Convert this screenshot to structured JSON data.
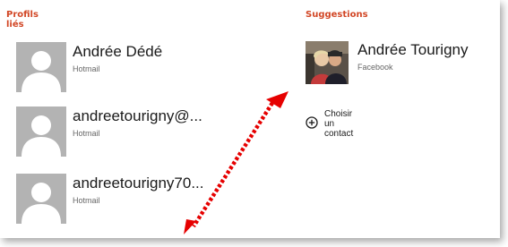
{
  "linked_profiles": {
    "title": "Profils liés",
    "items": [
      {
        "name": "Andrée Dédé",
        "service": "Hotmail"
      },
      {
        "name": "andreetourigny@...",
        "service": "Hotmail"
      },
      {
        "name": "andreetourigny70...",
        "service": "Hotmail"
      }
    ]
  },
  "suggestions": {
    "title": "Suggestions",
    "items": [
      {
        "name": "Andrée Tourigny",
        "service": "Facebook"
      }
    ],
    "add_contact_label": "Choisir un contact"
  },
  "colors": {
    "accent": "#d24726",
    "placeholder_avatar": "#b3b3b3",
    "arrow": "#e60000"
  },
  "icons": [
    "person-placeholder-icon",
    "plus-circle-icon",
    "double-headed-arrow-icon"
  ]
}
